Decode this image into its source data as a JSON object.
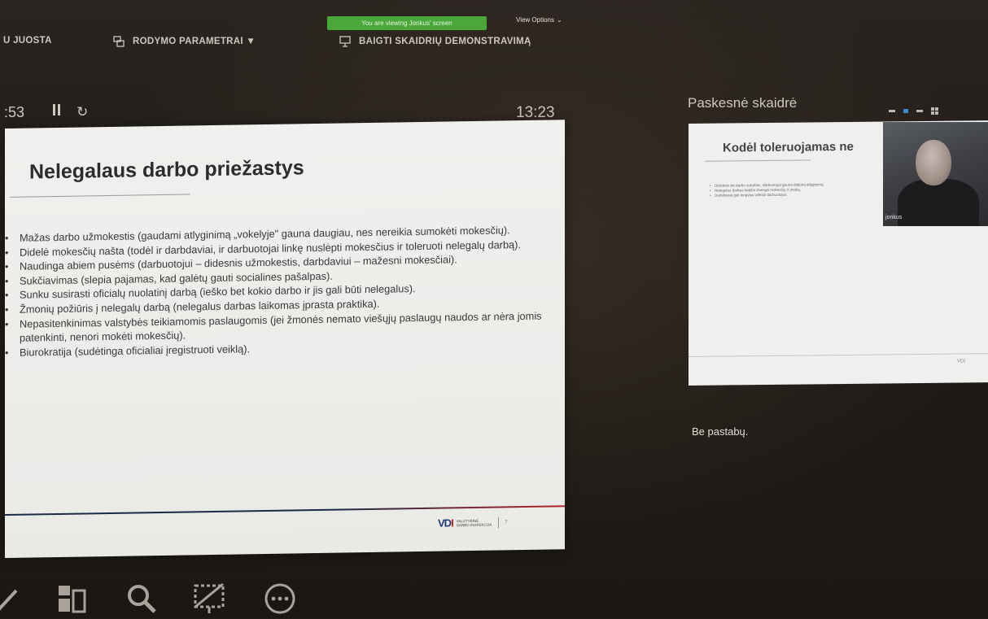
{
  "window": {
    "share_banner": "You are viewing Jonkus' screen",
    "view_options": "View Options",
    "view_options_caret": "⌄"
  },
  "toolbar": {
    "tab_partial": "U JUOSTA",
    "display_settings": "RODYMO PARAMETRAI ▼",
    "end_show": "BAIGTI SKAIDRIŲ DEMONSTRAVIMĄ"
  },
  "timer": {
    "elapsed": ":53",
    "clock": "13:23"
  },
  "slide": {
    "title": "Nelegalaus darbo priežastys",
    "bullets": [
      "Mažas darbo užmokestis (gaudami atlyginimą „vokelyje\" gauna daugiau, nes nereikia sumokėti mokesčių).",
      "Didelė mokesčių našta (todėl ir darbdaviai, ir darbuotojai linkę nuslėpti mokesčius ir toleruoti nelegalų darbą).",
      "Naudinga abiem pusėms (darbuotojui – didesnis užmokestis, darbdaviui – mažesni mokesčiai).",
      "Sukčiavimas (slepia pajamas, kad galėtų gauti socialines pašalpas).",
      "Sunku susirasti oficialų nuolatinį darbą (ieško bet kokio darbo ir jis gali būti nelegalus).",
      "Žmonių požiūris į nelegalų darbą (nelegalus darbas laikomas įprasta praktika).",
      "Nepasitenkinimas valstybės teikiamomis paslaugomis (jei žmonės nemato viešųjų paslaugų naudos ar nėra jomis patenkinti, nenori mokėti mokesčių).",
      "Biurokratija (sudėtinga oficialiai įregistruoti veiklą)."
    ],
    "logo_mark_main": "VD",
    "logo_mark_accent": "I",
    "logo_line1": "VALSTYBINĖ",
    "logo_line2": "DARBO INSPEKCIJA",
    "slide_number": "7"
  },
  "next_pane": {
    "label": "Paskesnė skaidrė",
    "heading": "Kodėl toleruojamas ne",
    "bullets": [
      "Dirbdami be darbo sutarties, darbuotojai gauna didesnį atlyginimą.",
      "Nelegalus darbas leidžia išvengti mokesčių ir įmokų.",
      "Darbdaviai gali lengviau atleisti darbuotojus."
    ],
    "footer_logo": "VDI",
    "webcam_name": "jonkus"
  },
  "notes": {
    "text": "Be pastabų."
  },
  "colors": {
    "share_green": "#4aa83a",
    "brand_navy": "#1d3a70",
    "brand_red": "#b6262b"
  },
  "icons": [
    "display-settings-icon",
    "end-show-icon",
    "pause-icon",
    "reset-icon",
    "pen-icon",
    "slides-grid-icon",
    "zoom-icon",
    "hide-screen-icon",
    "more-options-icon"
  ]
}
